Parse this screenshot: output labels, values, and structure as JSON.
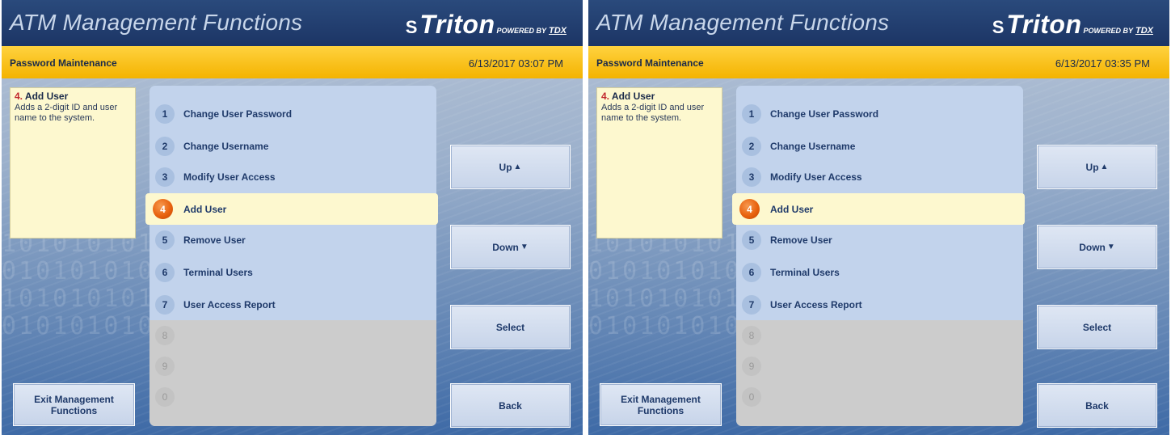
{
  "screens": [
    {
      "app_title": "ATM Management Functions",
      "brand": {
        "mark": "S",
        "name": "Triton",
        "sub": "POWERED BY",
        "sub2": "TDX"
      },
      "section_title": "Password Maintenance",
      "datetime": "6/13/2017  03:07 PM",
      "help": {
        "number": "4.",
        "title": "Add User",
        "text": "Adds a 2-digit ID and user name to the system."
      },
      "menu": [
        {
          "num": "1",
          "label": "Change User Password"
        },
        {
          "num": "2",
          "label": "Change Username"
        },
        {
          "num": "3",
          "label": "Modify User Access"
        },
        {
          "num": "4",
          "label": "Add User"
        },
        {
          "num": "5",
          "label": "Remove User"
        },
        {
          "num": "6",
          "label": "Terminal Users"
        },
        {
          "num": "7",
          "label": "User Access Report"
        },
        {
          "num": "8",
          "label": ""
        },
        {
          "num": "9",
          "label": ""
        },
        {
          "num": "0",
          "label": ""
        }
      ],
      "buttons": {
        "up": "Up",
        "down": "Down",
        "select": "Select",
        "back": "Back",
        "exit": "Exit Management Functions"
      }
    },
    {
      "app_title": "ATM Management Functions",
      "brand": {
        "mark": "S",
        "name": "Triton",
        "sub": "POWERED BY",
        "sub2": "TDX"
      },
      "section_title": "Password Maintenance",
      "datetime": "6/13/2017  03:35 PM",
      "help": {
        "number": "4.",
        "title": "Add User",
        "text": "Adds a 2-digit ID and user name to the system."
      },
      "menu": [
        {
          "num": "1",
          "label": "Change User Password"
        },
        {
          "num": "2",
          "label": "Change Username"
        },
        {
          "num": "3",
          "label": "Modify User Access"
        },
        {
          "num": "4",
          "label": "Add User"
        },
        {
          "num": "5",
          "label": "Remove User"
        },
        {
          "num": "6",
          "label": "Terminal Users"
        },
        {
          "num": "7",
          "label": "User Access Report"
        },
        {
          "num": "8",
          "label": ""
        },
        {
          "num": "9",
          "label": ""
        },
        {
          "num": "0",
          "label": ""
        }
      ],
      "buttons": {
        "up": "Up",
        "down": "Down",
        "select": "Select",
        "back": "Back",
        "exit": "Exit Management Functions"
      }
    }
  ],
  "icons": {
    "up": "triangle-up-icon",
    "down": "triangle-down-icon"
  },
  "colors": {
    "title_bar": "#1c3565",
    "header_bar": "#f4b300",
    "selected_row": "#fdf8cf",
    "selected_circle": "#e8620f"
  }
}
